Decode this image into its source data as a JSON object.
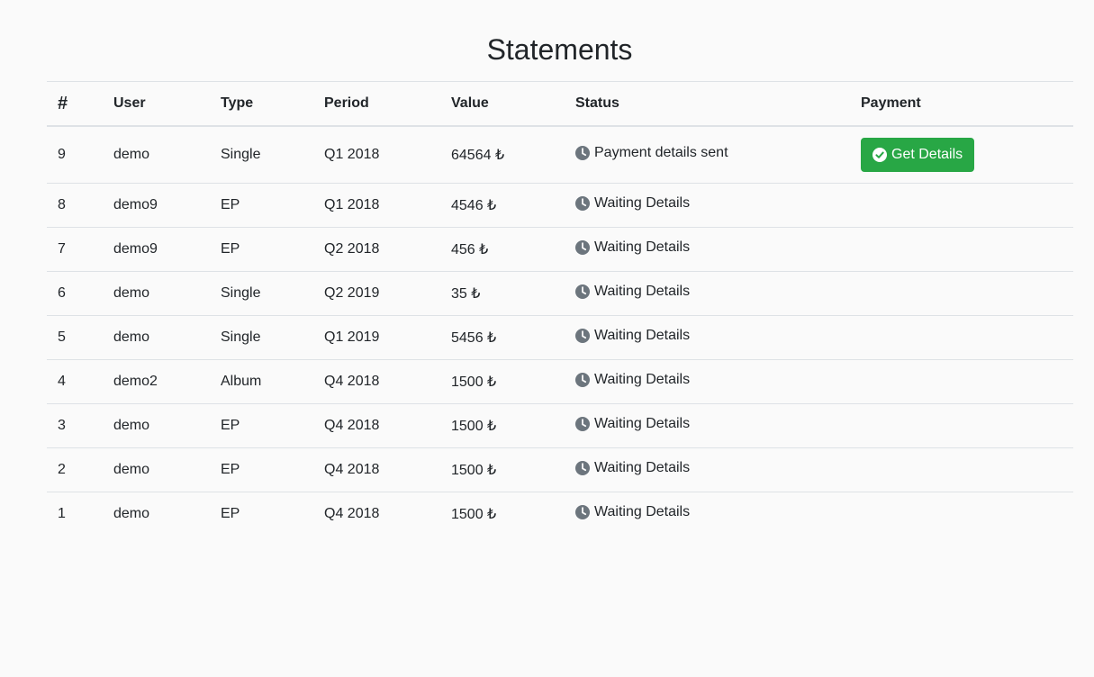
{
  "page": {
    "title": "Statements"
  },
  "table": {
    "headers": {
      "num": "#",
      "user": "User",
      "type": "Type",
      "period": "Period",
      "value": "Value",
      "status": "Status",
      "payment": "Payment"
    },
    "rows": [
      {
        "num": "9",
        "user": "demo",
        "type": "Single",
        "period": "Q1 2018",
        "value": "64564 ₺",
        "status": "Payment details sent",
        "payment_button": "Get Details"
      },
      {
        "num": "8",
        "user": "demo9",
        "type": "EP",
        "period": "Q1 2018",
        "value": "4546 ₺",
        "status": "Waiting Details",
        "payment_button": ""
      },
      {
        "num": "7",
        "user": "demo9",
        "type": "EP",
        "period": "Q2 2018",
        "value": "456 ₺",
        "status": "Waiting Details",
        "payment_button": ""
      },
      {
        "num": "6",
        "user": "demo",
        "type": "Single",
        "period": "Q2 2019",
        "value": "35 ₺",
        "status": "Waiting Details",
        "payment_button": ""
      },
      {
        "num": "5",
        "user": "demo",
        "type": "Single",
        "period": "Q1 2019",
        "value": "5456 ₺",
        "status": "Waiting Details",
        "payment_button": ""
      },
      {
        "num": "4",
        "user": "demo2",
        "type": "Album",
        "period": "Q4 2018",
        "value": "1500 ₺",
        "status": "Waiting Details",
        "payment_button": ""
      },
      {
        "num": "3",
        "user": "demo",
        "type": "EP",
        "period": "Q4 2018",
        "value": "1500 ₺",
        "status": "Waiting Details",
        "payment_button": ""
      },
      {
        "num": "2",
        "user": "demo",
        "type": "EP",
        "period": "Q4 2018",
        "value": "1500 ₺",
        "status": "Waiting Details",
        "payment_button": ""
      },
      {
        "num": "1",
        "user": "demo",
        "type": "EP",
        "period": "Q4 2018",
        "value": "1500 ₺",
        "status": "Waiting Details",
        "payment_button": ""
      }
    ]
  },
  "icons": {
    "status": "clock-icon",
    "button": "check-circle-icon"
  },
  "colors": {
    "background": "#fafafa",
    "text": "#212529",
    "border": "#dee2e6",
    "success": "#28a745",
    "icon_gray": "#6c757d"
  }
}
